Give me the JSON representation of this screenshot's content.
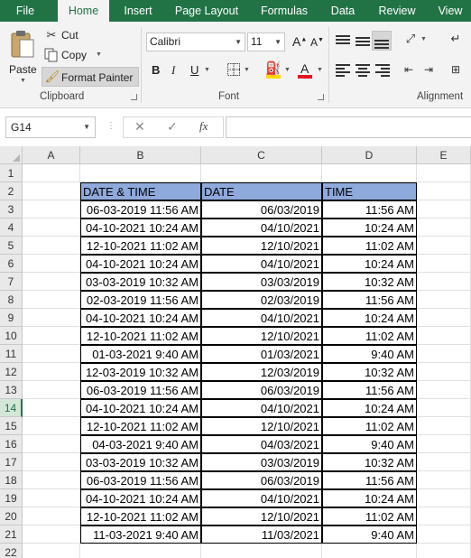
{
  "ribbon_tabs": [
    "File",
    "Home",
    "Insert",
    "Page Layout",
    "Formulas",
    "Data",
    "Review",
    "View"
  ],
  "active_tab": "Home",
  "clipboard": {
    "paste": "Paste",
    "cut": "Cut",
    "copy": "Copy",
    "format_painter": "Format Painter",
    "label": "Clipboard"
  },
  "font": {
    "name": "Calibri",
    "size": "11",
    "grow": "A",
    "shrink": "A",
    "bold": "B",
    "italic": "I",
    "underline": "U",
    "font_color_letter": "A",
    "label": "Font"
  },
  "alignment": {
    "label": "Alignment"
  },
  "formula_bar": {
    "name_box": "G14",
    "cancel": "✕",
    "enter": "✓",
    "fx": "fx",
    "formula": ""
  },
  "columns": [
    "A",
    "B",
    "C",
    "D",
    "E"
  ],
  "rows": [
    "1",
    "2",
    "3",
    "4",
    "5",
    "6",
    "7",
    "8",
    "9",
    "10",
    "11",
    "12",
    "13",
    "14",
    "15",
    "16",
    "17",
    "18",
    "19",
    "20",
    "21",
    "22"
  ],
  "selected_row": "14",
  "table": {
    "headers": [
      "DATE & TIME",
      "DATE",
      "TIME"
    ],
    "rows": [
      [
        "06-03-2019 11:56 AM",
        "06/03/2019",
        "11:56 AM"
      ],
      [
        "04-10-2021 10:24 AM",
        "04/10/2021",
        "10:24 AM"
      ],
      [
        "12-10-2021 11:02 AM",
        "12/10/2021",
        "11:02 AM"
      ],
      [
        "04-10-2021 10:24 AM",
        "04/10/2021",
        "10:24 AM"
      ],
      [
        "03-03-2019 10:32 AM",
        "03/03/2019",
        "10:32 AM"
      ],
      [
        "02-03-2019 11:56 AM",
        "02/03/2019",
        "11:56 AM"
      ],
      [
        "04-10-2021 10:24 AM",
        "04/10/2021",
        "10:24 AM"
      ],
      [
        "12-10-2021 11:02 AM",
        "12/10/2021",
        "11:02 AM"
      ],
      [
        "01-03-2021 9:40 AM",
        "01/03/2021",
        "9:40 AM"
      ],
      [
        "12-03-2019 10:32 AM",
        "12/03/2019",
        "10:32 AM"
      ],
      [
        "06-03-2019 11:56 AM",
        "06/03/2019",
        "11:56 AM"
      ],
      [
        "04-10-2021 10:24 AM",
        "04/10/2021",
        "10:24 AM"
      ],
      [
        "12-10-2021 11:02 AM",
        "12/10/2021",
        "11:02 AM"
      ],
      [
        "04-03-2021 9:40 AM",
        "04/03/2021",
        "9:40 AM"
      ],
      [
        "03-03-2019 10:32 AM",
        "03/03/2019",
        "10:32 AM"
      ],
      [
        "06-03-2019 11:56 AM",
        "06/03/2019",
        "11:56 AM"
      ],
      [
        "04-10-2021 10:24 AM",
        "04/10/2021",
        "10:24 AM"
      ],
      [
        "12-10-2021 11:02 AM",
        "12/10/2021",
        "11:02 AM"
      ],
      [
        "11-03-2021 9:40 AM",
        "11/03/2021",
        "9:40 AM"
      ]
    ]
  },
  "colors": {
    "accent": "#217346",
    "header_fill": "#8ea9db",
    "font_color_bar": "#e81123",
    "fill_color_bar": "#ffd800"
  }
}
